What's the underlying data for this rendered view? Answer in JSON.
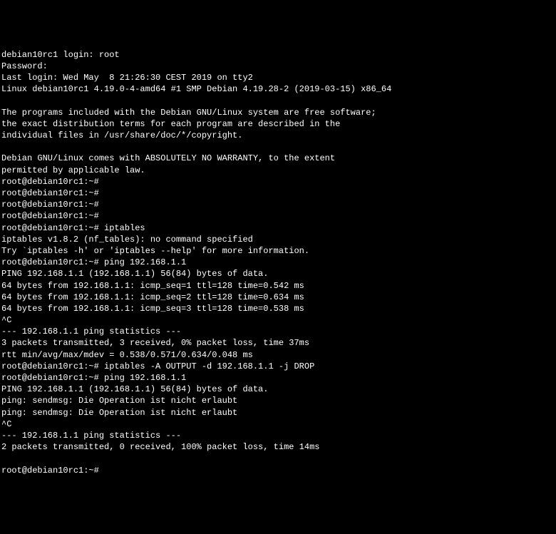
{
  "lines": [
    "debian10rc1 login: root",
    "Password:",
    "Last login: Wed May  8 21:26:30 CEST 2019 on tty2",
    "Linux debian10rc1 4.19.0-4-amd64 #1 SMP Debian 4.19.28-2 (2019-03-15) x86_64",
    "",
    "The programs included with the Debian GNU/Linux system are free software;",
    "the exact distribution terms for each program are described in the",
    "individual files in /usr/share/doc/*/copyright.",
    "",
    "Debian GNU/Linux comes with ABSOLUTELY NO WARRANTY, to the extent",
    "permitted by applicable law.",
    "root@debian10rc1:~#",
    "root@debian10rc1:~#",
    "root@debian10rc1:~#",
    "root@debian10rc1:~#",
    "root@debian10rc1:~# iptables",
    "iptables v1.8.2 (nf_tables): no command specified",
    "Try `iptables -h' or 'iptables --help' for more information.",
    "root@debian10rc1:~# ping 192.168.1.1",
    "PING 192.168.1.1 (192.168.1.1) 56(84) bytes of data.",
    "64 bytes from 192.168.1.1: icmp_seq=1 ttl=128 time=0.542 ms",
    "64 bytes from 192.168.1.1: icmp_seq=2 ttl=128 time=0.634 ms",
    "64 bytes from 192.168.1.1: icmp_seq=3 ttl=128 time=0.538 ms",
    "^C",
    "--- 192.168.1.1 ping statistics ---",
    "3 packets transmitted, 3 received, 0% packet loss, time 37ms",
    "rtt min/avg/max/mdev = 0.538/0.571/0.634/0.048 ms",
    "root@debian10rc1:~# iptables -A OUTPUT -d 192.168.1.1 -j DROP",
    "root@debian10rc1:~# ping 192.168.1.1",
    "PING 192.168.1.1 (192.168.1.1) 56(84) bytes of data.",
    "ping: sendmsg: Die Operation ist nicht erlaubt",
    "ping: sendmsg: Die Operation ist nicht erlaubt",
    "^C",
    "--- 192.168.1.1 ping statistics ---",
    "2 packets transmitted, 0 received, 100% packet loss, time 14ms",
    "",
    "root@debian10rc1:~#"
  ]
}
